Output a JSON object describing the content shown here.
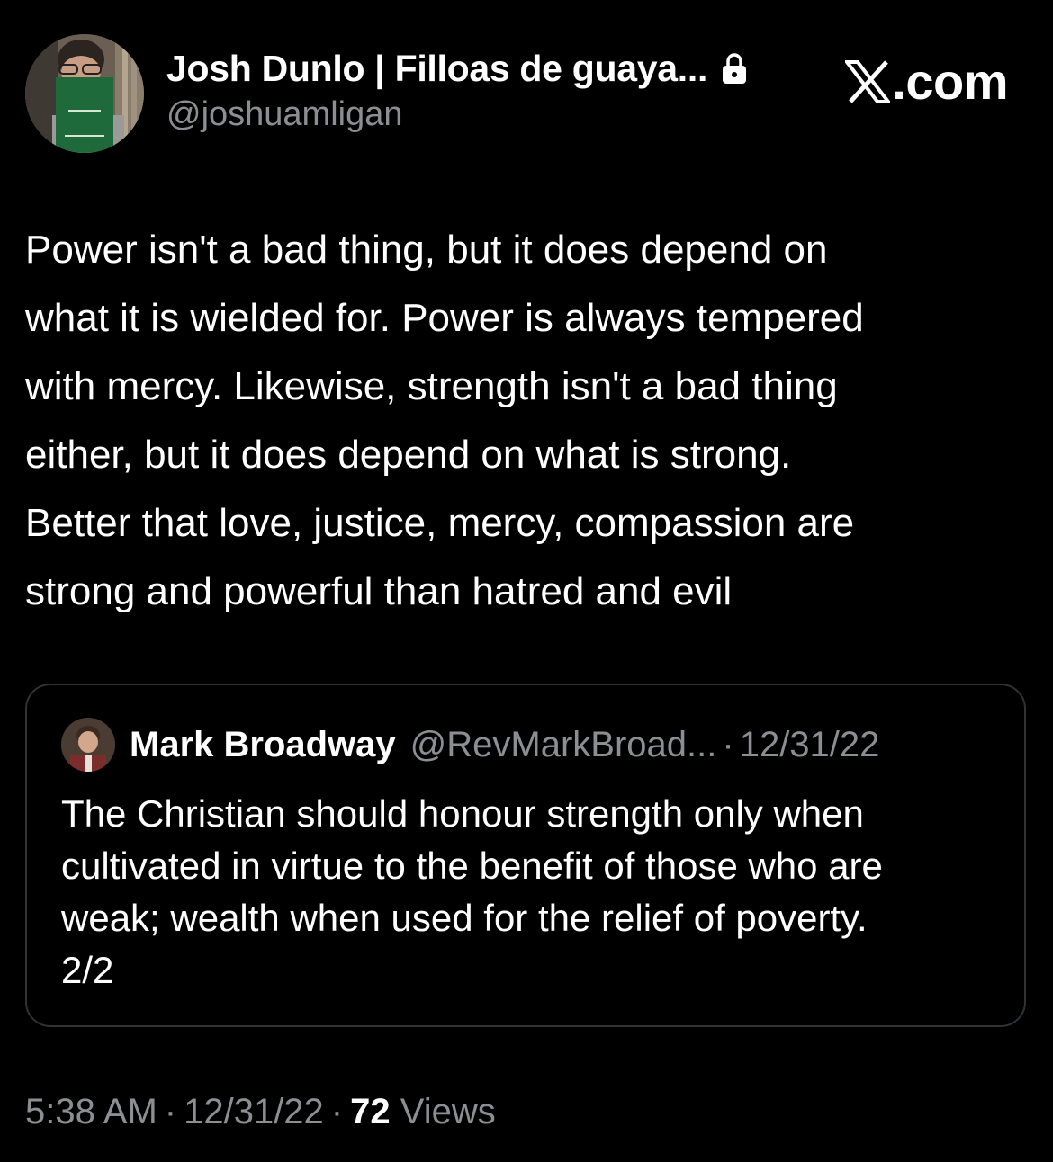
{
  "author": {
    "display_name": "Josh Dunlo | Filloas de guaya...",
    "handle": "@joshuamligan",
    "avatar_icon": "profile-photo",
    "lock_icon": "lock-icon"
  },
  "brand": {
    "logo_icon": "x-logo-icon",
    "text": ".com"
  },
  "tweet": {
    "lines": [
      "Power isn't a bad thing, but it does depend on",
      "what it is wielded for. Power is always tempered",
      "with mercy. Likewise, strength isn't a bad thing",
      "either, but it does depend on what is strong.",
      "Better that love, justice, mercy, compassion are",
      "strong and powerful than hatred and evil"
    ]
  },
  "quote": {
    "name": "Mark Broadway",
    "handle": "@RevMarkBroad...",
    "separator": "·",
    "date": "12/31/22",
    "lines": [
      "The Christian should honour strength only when",
      "cultivated in virtue to the benefit of those who are",
      "weak; wealth when used for the relief of poverty.",
      "2/2"
    ]
  },
  "meta": {
    "time": "5:38 AM",
    "separator": "·",
    "date": "12/31/22",
    "views_count": "72",
    "views_label": " Views"
  },
  "colors": {
    "background": "#000000",
    "text": "#ffffff",
    "secondary": "#8b8f94",
    "border": "#2f3336"
  }
}
